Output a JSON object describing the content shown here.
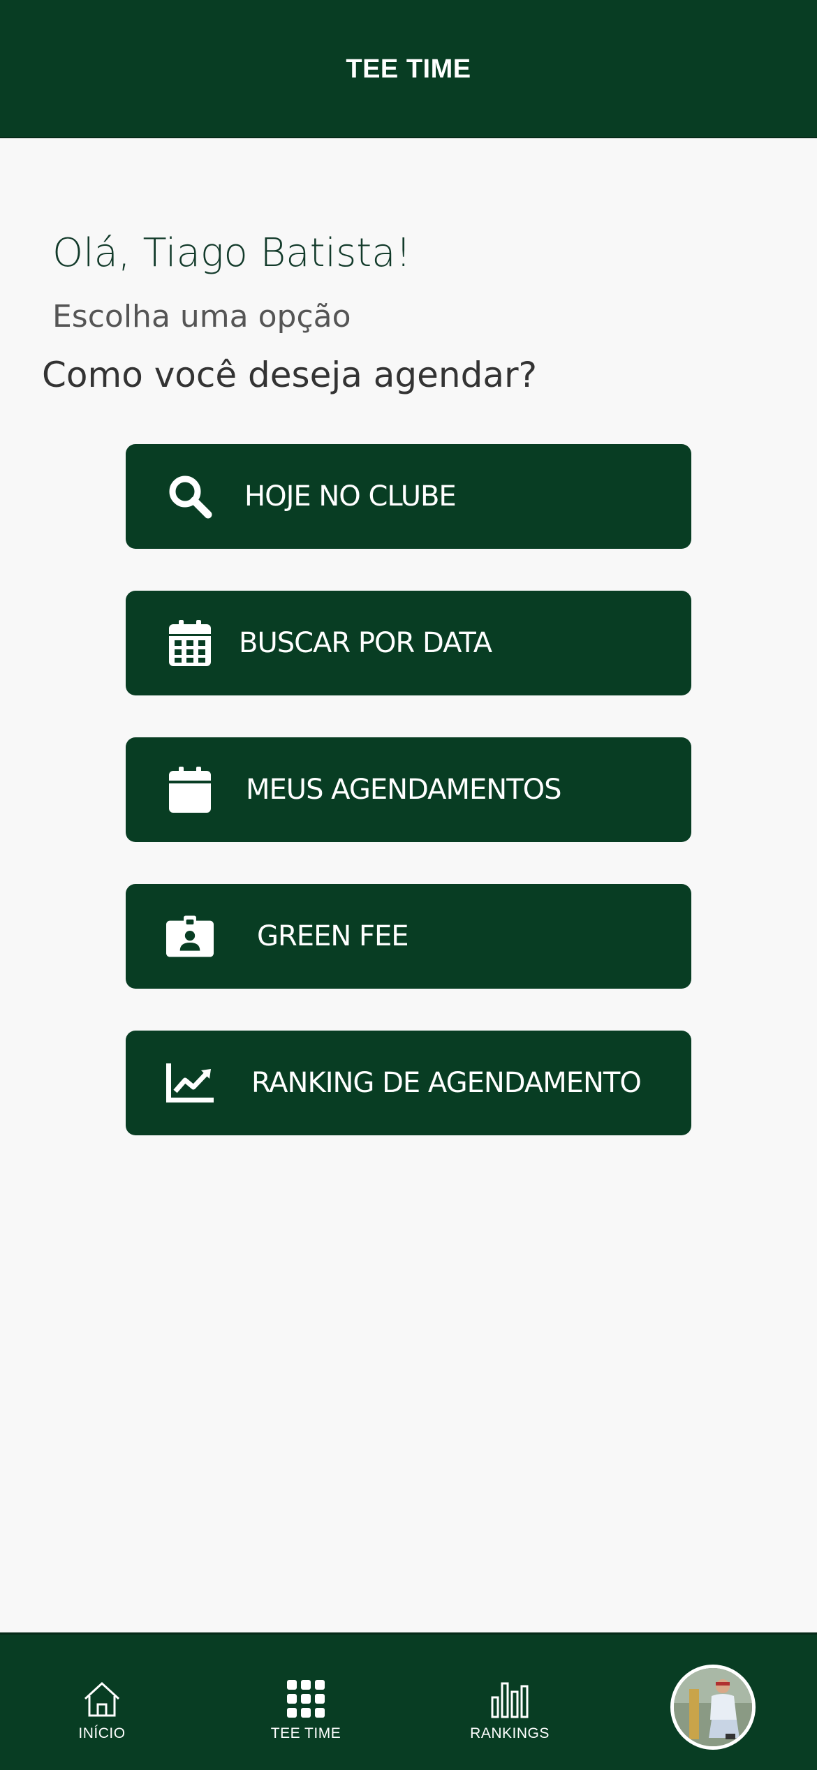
{
  "header": {
    "title": "TEE TIME"
  },
  "main": {
    "greeting": "Olá, Tiago Batista!",
    "subtitle": "Escolha uma opção",
    "question": "Como você deseja agendar?",
    "options": [
      {
        "label": "HOJE NO CLUBE",
        "icon": "search-icon"
      },
      {
        "label": "BUSCAR POR DATA",
        "icon": "calendar-grid-icon"
      },
      {
        "label": "MEUS AGENDAMENTOS",
        "icon": "calendar-icon"
      },
      {
        "label": "GREEN FEE",
        "icon": "id-badge-icon"
      },
      {
        "label": "RANKING DE AGENDAMENTO",
        "icon": "chart-line-icon"
      }
    ]
  },
  "nav": {
    "items": [
      {
        "label": "INÍCIO",
        "icon": "home-icon"
      },
      {
        "label": "TEE TIME",
        "icon": "grid-icon"
      },
      {
        "label": "RANKINGS",
        "icon": "bar-chart-icon"
      }
    ],
    "avatar": "user-avatar"
  },
  "colors": {
    "primary": "#083d23",
    "background": "#f8f8f8",
    "text_light": "#ffffff"
  }
}
